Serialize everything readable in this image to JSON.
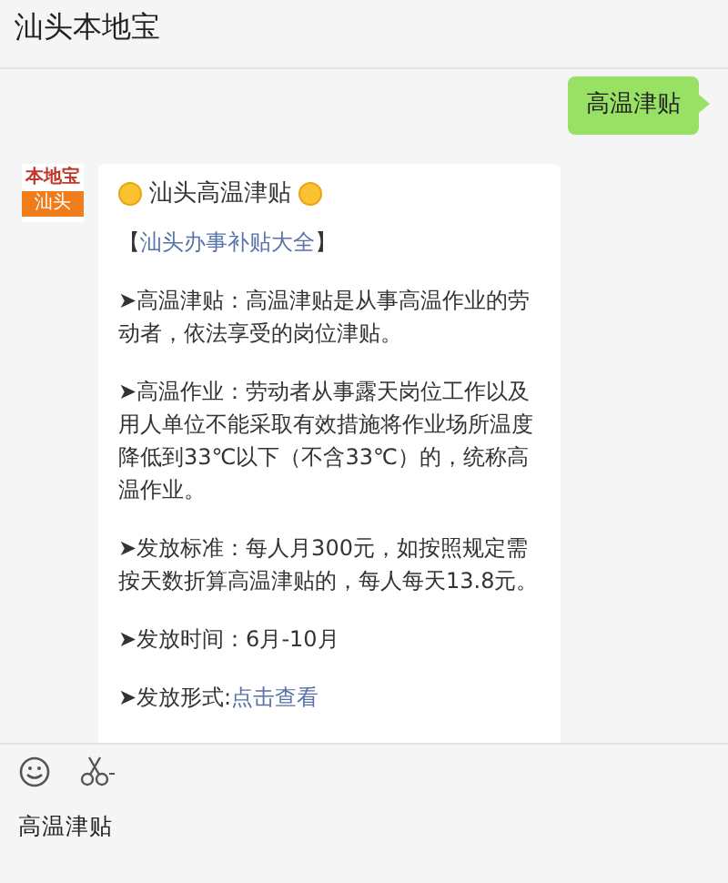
{
  "header": {
    "title": "汕头本地宝"
  },
  "sent_message": {
    "text": "高温津贴"
  },
  "received_message": {
    "avatar": {
      "name": "本地宝",
      "city": "汕头"
    },
    "title": "汕头高温津贴",
    "paragraphs": [
      [
        {
          "text": "【",
          "link": false
        },
        {
          "text": "汕头办事补贴大全",
          "link": true
        },
        {
          "text": "】",
          "link": false
        }
      ],
      [
        {
          "text": "➤高温津贴：高温津贴是从事高温作业的劳动者，依法享受的岗位津贴。",
          "link": false
        }
      ],
      [
        {
          "text": "➤高温作业：劳动者从事露天岗位工作以及用人单位不能采取有效措施将作业场所温度降低到33℃以下（不含33℃）的，统称高温作业。",
          "link": false
        }
      ],
      [
        {
          "text": "➤发放标准：每人月300元，如按照规定需按天数折算高温津贴的，每人每天13.8元。",
          "link": false
        }
      ],
      [
        {
          "text": "➤发放时间：6月-10月",
          "link": false
        }
      ],
      [
        {
          "text": "➤发放形式:",
          "link": false
        },
        {
          "text": "点击查看",
          "link": true
        }
      ]
    ]
  },
  "input": {
    "value": "高温津贴"
  }
}
